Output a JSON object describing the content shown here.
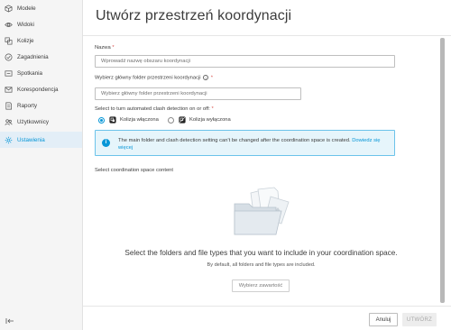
{
  "sidebar": {
    "items": [
      {
        "label": "Modele",
        "icon": "cube-icon"
      },
      {
        "label": "Widoki",
        "icon": "eye-icon"
      },
      {
        "label": "Kolizje",
        "icon": "clash-icon"
      },
      {
        "label": "Zagadnienia",
        "icon": "issue-check-icon"
      },
      {
        "label": "Spotkania",
        "icon": "meeting-icon"
      },
      {
        "label": "Korespondencja",
        "icon": "mail-icon"
      },
      {
        "label": "Raporty",
        "icon": "report-icon"
      },
      {
        "label": "Użytkownicy",
        "icon": "users-icon"
      },
      {
        "label": "Ustawienia",
        "icon": "gear-icon",
        "active": true
      }
    ],
    "accent": "#0696d7"
  },
  "header": {
    "title": "Utwórz przestrzeń koordynacji"
  },
  "form": {
    "name_label": "Nazwa",
    "name_placeholder": "Wprowadź nazwę obszaru koordynacji",
    "folder_label": "Wybierz główny folder przestrzeni koordynacji",
    "folder_placeholder": "Wybierz główny folder przestrzeni koordynacji",
    "required_mark": "*",
    "info_glyph": "i",
    "clash_label": "Select to turn automated clash detection on or off:",
    "clash_on_label": "Kolizja włączona",
    "clash_off_label": "Kolizja wyłączona",
    "clash_selected": "on"
  },
  "banner": {
    "text": "The main folder and clash detection setting can't be changed after the coordination space is created.",
    "link": "Dowiedz się więcej",
    "icon": "info-icon",
    "glyph": "i"
  },
  "content_section": {
    "label": "Select coordination space content",
    "empty_title": "Select the folders and file types that you want to include in your coordination space.",
    "empty_sub": "By default, all folders and file types are included.",
    "choose_button": "Wybierz zawartość"
  },
  "footer": {
    "cancel": "Anuluj",
    "create": "UTWÓRZ"
  }
}
